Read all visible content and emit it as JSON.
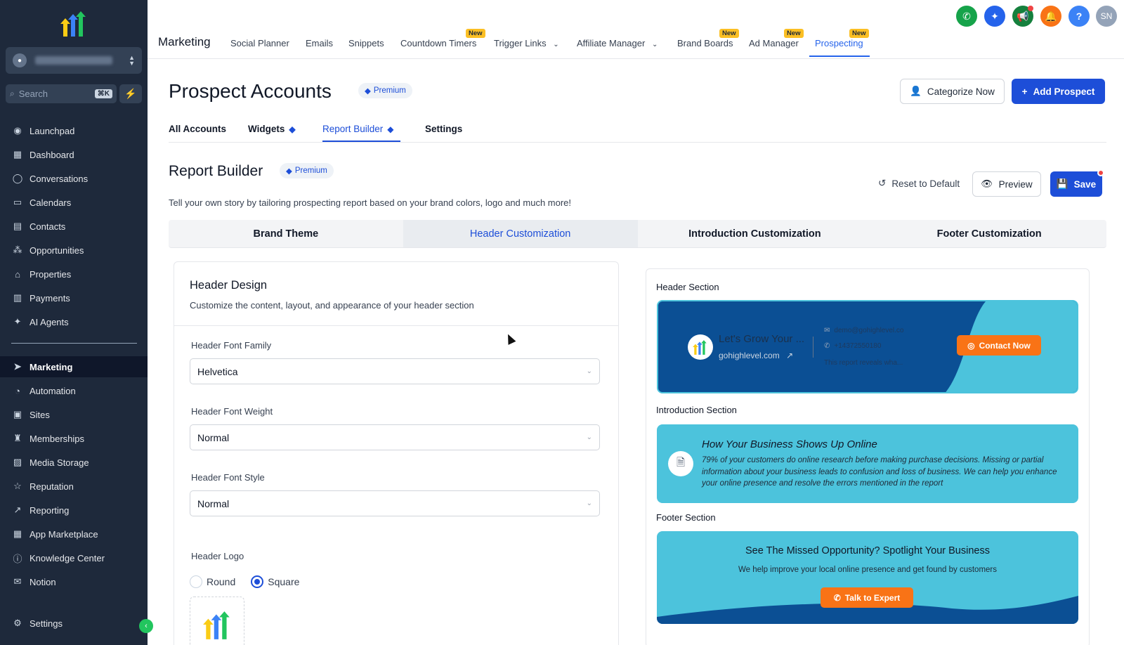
{
  "sidebar": {
    "search_placeholder": "Search",
    "search_shortcut": "⌘K",
    "items": [
      {
        "label": "Launchpad",
        "icon": "launchpad-icon"
      },
      {
        "label": "Dashboard",
        "icon": "dashboard-icon"
      },
      {
        "label": "Conversations",
        "icon": "chat-icon"
      },
      {
        "label": "Calendars",
        "icon": "calendar-icon"
      },
      {
        "label": "Contacts",
        "icon": "contacts-icon"
      },
      {
        "label": "Opportunities",
        "icon": "opportunities-icon"
      },
      {
        "label": "Properties",
        "icon": "home-icon"
      },
      {
        "label": "Payments",
        "icon": "receipt-icon"
      },
      {
        "label": "AI Agents",
        "icon": "sparkle-icon"
      }
    ],
    "items2": [
      {
        "label": "Marketing",
        "icon": "send-icon"
      },
      {
        "label": "Automation",
        "icon": "automation-icon"
      },
      {
        "label": "Sites",
        "icon": "sites-icon"
      },
      {
        "label": "Memberships",
        "icon": "membership-icon"
      },
      {
        "label": "Media Storage",
        "icon": "image-icon"
      },
      {
        "label": "Reputation",
        "icon": "star-icon"
      },
      {
        "label": "Reporting",
        "icon": "trend-icon"
      },
      {
        "label": "App Marketplace",
        "icon": "grid-icon"
      },
      {
        "label": "Knowledge Center",
        "icon": "info-icon"
      },
      {
        "label": "Notion",
        "icon": "mail-icon"
      }
    ],
    "settings_label": "Settings"
  },
  "topbar": {
    "module_title": "Marketing",
    "tabs": [
      {
        "label": "Social Planner"
      },
      {
        "label": "Emails"
      },
      {
        "label": "Snippets"
      },
      {
        "label": "Countdown Timers",
        "badge": "New"
      },
      {
        "label": "Trigger Links"
      },
      {
        "label": "Affiliate Manager"
      },
      {
        "label": "Brand Boards",
        "badge": "New"
      },
      {
        "label": "Ad Manager",
        "badge": "New"
      },
      {
        "label": "Prospecting",
        "badge": "New"
      }
    ],
    "avatar_initials": "SN",
    "help": "?"
  },
  "page": {
    "title": "Prospect Accounts",
    "premium": "Premium",
    "categorize_btn": "Categorize Now",
    "add_btn": "Add Prospect",
    "subtabs": [
      "All Accounts",
      "Widgets",
      "Report Builder",
      "Settings"
    ],
    "section_title": "Report Builder",
    "section_premium": "Premium",
    "reset_btn": "Reset to Default",
    "preview_btn": "Preview",
    "save_btn": "Save",
    "description": "Tell your own story by tailoring prospecting report based on your brand colors, logo and much more!",
    "seg_tabs": [
      "Brand Theme",
      "Header Customization",
      "Introduction Customization",
      "Footer Customization"
    ]
  },
  "header_design": {
    "title": "Header Design",
    "desc": "Customize the content, layout, and appearance of your header section",
    "font_family_label": "Header Font Family",
    "font_family_value": "Helvetica",
    "font_weight_label": "Header Font Weight",
    "font_weight_value": "Normal",
    "font_style_label": "Header Font Style",
    "font_style_value": "Normal",
    "logo_label": "Header Logo",
    "logo_options": [
      "Round",
      "Square"
    ],
    "logo_selected": "Square"
  },
  "preview": {
    "header_label": "Header Section",
    "header_title": "Let's Grow Your ...",
    "header_site": "gohighlevel.com",
    "header_email": "demo@gohighlevel.co",
    "header_phone": "+14372550180",
    "header_note": "This report reveals wha...",
    "contact_btn": "Contact Now",
    "intro_label": "Introduction Section",
    "intro_title": "How Your Business Shows Up Online",
    "intro_body": "79% of your customers do online research before making purchase decisions. Missing or partial information about your business leads to confusion and loss of business. We can help you enhance your online presence and resolve the errors mentioned in the report",
    "footer_label": "Footer Section",
    "footer_title": "See The Missed Opportunity? Spotlight Your Business",
    "footer_sub": "We help improve your local online presence and get found by customers",
    "footer_btn": "Talk to Expert"
  },
  "colors": {
    "sidebar_bg": "#1e293b",
    "accent": "#1d4ed8",
    "header_preview_bg": "#0b4f94",
    "preview_teal": "#4cc3dc",
    "cta_orange": "#f97316"
  }
}
